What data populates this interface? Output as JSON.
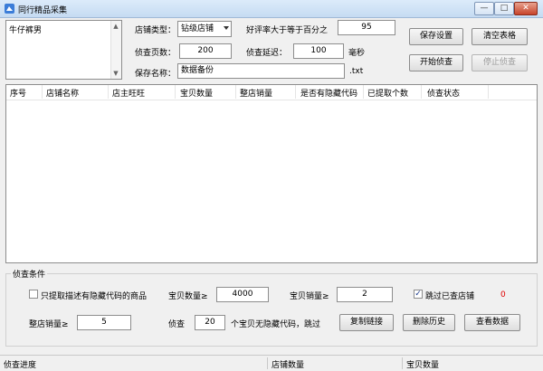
{
  "window": {
    "title": "同行精品采集",
    "min_glyph": "—",
    "max_glyph": "□",
    "close_glyph": "✕"
  },
  "keywords": {
    "text": "牛仔裤男"
  },
  "settings": {
    "shop_type_label": "店铺类型：",
    "shop_type_value": "钻级店铺",
    "rating_label": "好评率大于等于百分之",
    "rating_value": "95",
    "pages_label": "侦查页数：",
    "pages_value": "200",
    "delay_label": "侦查延迟：",
    "delay_value": "100",
    "delay_unit": "毫秒",
    "save_name_label": "保存名称：",
    "save_name_value": "数据备份",
    "save_ext": ".txt"
  },
  "buttons": {
    "save_settings": "保存设置",
    "clear_table": "清空表格",
    "start_scan": "开始侦查",
    "stop_scan": "停止侦查",
    "copy_links": "复制链接",
    "delete_history": "删除历史",
    "view_data": "查看数据"
  },
  "table": {
    "columns": [
      "序号",
      "店铺名称",
      "店主旺旺",
      "宝贝数量",
      "整店销量",
      "是否有隐藏代码",
      "已提取个数",
      "侦查状态"
    ]
  },
  "conditions": {
    "title": "侦查条件",
    "only_hidden_label": "只提取描述有隐藏代码的商品",
    "only_hidden_checked": false,
    "item_count_label": "宝贝数量≥",
    "item_count_value": "4000",
    "item_sales_label": "宝贝销量≥",
    "item_sales_value": "2",
    "skip_scanned_label": "跳过已查店铺",
    "skip_scanned_checked": true,
    "skipped_count": "0",
    "shop_sales_label": "整店销量≥",
    "shop_sales_value": "5",
    "scan_label": "侦查",
    "scan_value": "20",
    "scan_suffix": "个宝贝无隐藏代码，跳过"
  },
  "statusbar": {
    "progress_label": "侦查进度",
    "shop_count_label": "店铺数量",
    "item_count_label": "宝贝数量"
  },
  "colors": {
    "title_bar": "#c5dbf2",
    "close_button": "#c7432a",
    "count_red": "#e00000"
  }
}
